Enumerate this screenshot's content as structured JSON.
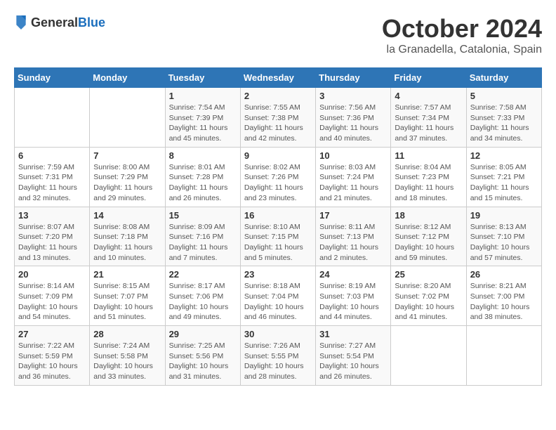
{
  "header": {
    "logo_general": "General",
    "logo_blue": "Blue",
    "month_title": "October 2024",
    "location": "la Granadella, Catalonia, Spain"
  },
  "calendar": {
    "days_of_week": [
      "Sunday",
      "Monday",
      "Tuesday",
      "Wednesday",
      "Thursday",
      "Friday",
      "Saturday"
    ],
    "weeks": [
      [
        {
          "day": "",
          "info": ""
        },
        {
          "day": "",
          "info": ""
        },
        {
          "day": "1",
          "info": "Sunrise: 7:54 AM\nSunset: 7:39 PM\nDaylight: 11 hours and 45 minutes."
        },
        {
          "day": "2",
          "info": "Sunrise: 7:55 AM\nSunset: 7:38 PM\nDaylight: 11 hours and 42 minutes."
        },
        {
          "day": "3",
          "info": "Sunrise: 7:56 AM\nSunset: 7:36 PM\nDaylight: 11 hours and 40 minutes."
        },
        {
          "day": "4",
          "info": "Sunrise: 7:57 AM\nSunset: 7:34 PM\nDaylight: 11 hours and 37 minutes."
        },
        {
          "day": "5",
          "info": "Sunrise: 7:58 AM\nSunset: 7:33 PM\nDaylight: 11 hours and 34 minutes."
        }
      ],
      [
        {
          "day": "6",
          "info": "Sunrise: 7:59 AM\nSunset: 7:31 PM\nDaylight: 11 hours and 32 minutes."
        },
        {
          "day": "7",
          "info": "Sunrise: 8:00 AM\nSunset: 7:29 PM\nDaylight: 11 hours and 29 minutes."
        },
        {
          "day": "8",
          "info": "Sunrise: 8:01 AM\nSunset: 7:28 PM\nDaylight: 11 hours and 26 minutes."
        },
        {
          "day": "9",
          "info": "Sunrise: 8:02 AM\nSunset: 7:26 PM\nDaylight: 11 hours and 23 minutes."
        },
        {
          "day": "10",
          "info": "Sunrise: 8:03 AM\nSunset: 7:24 PM\nDaylight: 11 hours and 21 minutes."
        },
        {
          "day": "11",
          "info": "Sunrise: 8:04 AM\nSunset: 7:23 PM\nDaylight: 11 hours and 18 minutes."
        },
        {
          "day": "12",
          "info": "Sunrise: 8:05 AM\nSunset: 7:21 PM\nDaylight: 11 hours and 15 minutes."
        }
      ],
      [
        {
          "day": "13",
          "info": "Sunrise: 8:07 AM\nSunset: 7:20 PM\nDaylight: 11 hours and 13 minutes."
        },
        {
          "day": "14",
          "info": "Sunrise: 8:08 AM\nSunset: 7:18 PM\nDaylight: 11 hours and 10 minutes."
        },
        {
          "day": "15",
          "info": "Sunrise: 8:09 AM\nSunset: 7:16 PM\nDaylight: 11 hours and 7 minutes."
        },
        {
          "day": "16",
          "info": "Sunrise: 8:10 AM\nSunset: 7:15 PM\nDaylight: 11 hours and 5 minutes."
        },
        {
          "day": "17",
          "info": "Sunrise: 8:11 AM\nSunset: 7:13 PM\nDaylight: 11 hours and 2 minutes."
        },
        {
          "day": "18",
          "info": "Sunrise: 8:12 AM\nSunset: 7:12 PM\nDaylight: 10 hours and 59 minutes."
        },
        {
          "day": "19",
          "info": "Sunrise: 8:13 AM\nSunset: 7:10 PM\nDaylight: 10 hours and 57 minutes."
        }
      ],
      [
        {
          "day": "20",
          "info": "Sunrise: 8:14 AM\nSunset: 7:09 PM\nDaylight: 10 hours and 54 minutes."
        },
        {
          "day": "21",
          "info": "Sunrise: 8:15 AM\nSunset: 7:07 PM\nDaylight: 10 hours and 51 minutes."
        },
        {
          "day": "22",
          "info": "Sunrise: 8:17 AM\nSunset: 7:06 PM\nDaylight: 10 hours and 49 minutes."
        },
        {
          "day": "23",
          "info": "Sunrise: 8:18 AM\nSunset: 7:04 PM\nDaylight: 10 hours and 46 minutes."
        },
        {
          "day": "24",
          "info": "Sunrise: 8:19 AM\nSunset: 7:03 PM\nDaylight: 10 hours and 44 minutes."
        },
        {
          "day": "25",
          "info": "Sunrise: 8:20 AM\nSunset: 7:02 PM\nDaylight: 10 hours and 41 minutes."
        },
        {
          "day": "26",
          "info": "Sunrise: 8:21 AM\nSunset: 7:00 PM\nDaylight: 10 hours and 38 minutes."
        }
      ],
      [
        {
          "day": "27",
          "info": "Sunrise: 7:22 AM\nSunset: 5:59 PM\nDaylight: 10 hours and 36 minutes."
        },
        {
          "day": "28",
          "info": "Sunrise: 7:24 AM\nSunset: 5:58 PM\nDaylight: 10 hours and 33 minutes."
        },
        {
          "day": "29",
          "info": "Sunrise: 7:25 AM\nSunset: 5:56 PM\nDaylight: 10 hours and 31 minutes."
        },
        {
          "day": "30",
          "info": "Sunrise: 7:26 AM\nSunset: 5:55 PM\nDaylight: 10 hours and 28 minutes."
        },
        {
          "day": "31",
          "info": "Sunrise: 7:27 AM\nSunset: 5:54 PM\nDaylight: 10 hours and 26 minutes."
        },
        {
          "day": "",
          "info": ""
        },
        {
          "day": "",
          "info": ""
        }
      ]
    ]
  }
}
